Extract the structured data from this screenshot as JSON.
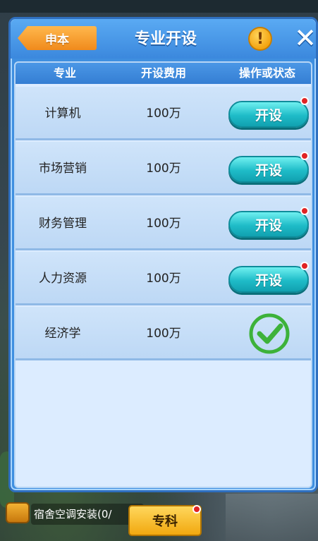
{
  "background": {
    "top_left_text": "",
    "top_right_text": "",
    "bottom_quest_text": "宿舍空调安装(0/",
    "bottom_tab_label": "专科"
  },
  "dialog": {
    "back_label": "申本",
    "title": "专业开设",
    "info_icon": "exclamation-icon",
    "close_icon": "close-icon"
  },
  "table": {
    "headers": {
      "name": "专业",
      "cost": "开设费用",
      "action": "操作或状态"
    },
    "rows": [
      {
        "name": "计算机",
        "cost": "100万",
        "action": "开设",
        "status": "available",
        "badge": true
      },
      {
        "name": "市场营销",
        "cost": "100万",
        "action": "开设",
        "status": "available",
        "badge": true
      },
      {
        "name": "财务管理",
        "cost": "100万",
        "action": "开设",
        "status": "available",
        "badge": true
      },
      {
        "name": "人力资源",
        "cost": "100万",
        "action": "开设",
        "status": "available",
        "badge": true
      },
      {
        "name": "经济学",
        "cost": "100万",
        "action": "",
        "status": "opened",
        "badge": false
      }
    ]
  },
  "colors": {
    "dialog_blue": "#3f8fe0",
    "button_cyan": "#1fbcc8",
    "back_orange": "#f08a1c",
    "check_green": "#3db23a",
    "badge_red": "#e02424"
  }
}
